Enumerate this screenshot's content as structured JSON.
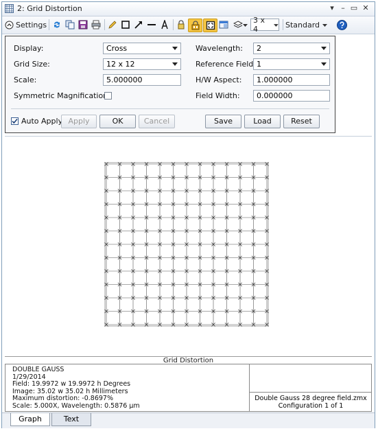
{
  "window": {
    "title": "2: Grid Distortion",
    "controls": [
      "▾",
      "–",
      "▭",
      "✕"
    ]
  },
  "toolbar": {
    "settings_label": "Settings",
    "layout_value": "3 x 4",
    "mode_value": "Standard"
  },
  "settings": {
    "display_label": "Display:",
    "display_value": "Cross",
    "grid_size_label": "Grid Size:",
    "grid_size_value": "12 x 12",
    "scale_label": "Scale:",
    "scale_value": "5.000000",
    "symmetric_label": "Symmetric Magnification:",
    "symmetric_checked": false,
    "wavelength_label": "Wavelength:",
    "wavelength_value": "2",
    "reference_field_label": "Reference Field:",
    "reference_field_value": "1",
    "hw_aspect_label": "H/W Aspect:",
    "hw_aspect_value": "1.000000",
    "field_width_label": "Field Width:",
    "field_width_value": "0.000000",
    "auto_apply_label": "Auto Apply",
    "auto_apply_checked": true,
    "apply_label": "Apply",
    "ok_label": "OK",
    "cancel_label": "Cancel",
    "save_label": "Save",
    "load_label": "Load",
    "reset_label": "Reset"
  },
  "graph": {
    "caption": "Grid Distortion",
    "grid_lines": 13
  },
  "info": {
    "lines": [
      "DOUBLE GAUSS",
      "1/29/2014",
      "Field: 19.9972 w 19.9972 h Degrees",
      "Image: 35.02 w 35.02 h Millimeters",
      "Maximum distortion: -0.8697%",
      "Scale: 5.000X, Wavelength: 0.5876 µm"
    ],
    "file": "Double Gauss 28 degree field.zmx",
    "configuration": "Configuration 1 of 1"
  },
  "tabs": [
    "Graph",
    "Text"
  ],
  "colors": {
    "accent": "#f5c542",
    "help": "#1f5fbf"
  }
}
